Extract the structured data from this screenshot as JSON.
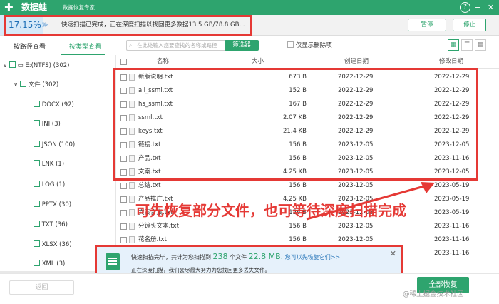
{
  "titlebar": {
    "logo": "✚",
    "app_name": "数据蛙",
    "subtitle": "数据恢复专家",
    "help": "?",
    "minimize": "−",
    "close": "✕"
  },
  "progress": {
    "percent_label": "17.15%",
    "percent_value": 17.15,
    "status": "快速扫描已完成，正在深度扫描以找回更多数据13.5 GB/78.8 GB...",
    "pause": "暂停",
    "stop": "停止"
  },
  "tabs": {
    "by_path": "按路径查看",
    "by_type": "按类型查看"
  },
  "tree": {
    "drive": "E:(NTFS) (302)",
    "folder": "文件 (302)",
    "types": [
      "DOCX (92)",
      "INI (3)",
      "JSON (100)",
      "LNK (1)",
      "LOG (1)",
      "PPTX (30)",
      "TXT (36)",
      "XLSX (36)",
      "XML (3)"
    ]
  },
  "toolbar": {
    "search_placeholder": "在此处输入您要查找的名称或路径",
    "filter": "筛选器",
    "deleted_only": "仅显示删除项"
  },
  "table": {
    "headers": {
      "name": "名称",
      "size": "大小",
      "created": "创建日期",
      "modified": "修改日期"
    },
    "rows": [
      {
        "name": "新版说明.txt",
        "size": "673  B",
        "created": "2022-12-29",
        "modified": "2022-12-29"
      },
      {
        "name": "ali_ssml.txt",
        "size": "152  B",
        "created": "2022-12-29",
        "modified": "2022-12-29"
      },
      {
        "name": "hs_ssml.txt",
        "size": "167  B",
        "created": "2022-12-29",
        "modified": "2022-12-29"
      },
      {
        "name": "ssml.txt",
        "size": "2.07 KB",
        "created": "2022-12-29",
        "modified": "2022-12-29"
      },
      {
        "name": "keys.txt",
        "size": "21.4 KB",
        "created": "2022-12-29",
        "modified": "2022-12-29"
      },
      {
        "name": "链接.txt",
        "size": "156  B",
        "created": "2023-12-05",
        "modified": "2023-12-05"
      },
      {
        "name": "产品.txt",
        "size": "156  B",
        "created": "2023-12-05",
        "modified": "2023-11-16"
      },
      {
        "name": "文案.txt",
        "size": "4.25 KB",
        "created": "2023-12-05",
        "modified": "2023-12-05"
      },
      {
        "name": "总结.txt",
        "size": "156  B",
        "created": "2023-12-05",
        "modified": "2023-05-19"
      },
      {
        "name": "产品推广.txt",
        "size": "4.25 KB",
        "created": "2023-12-05",
        "modified": "2023-05-19"
      },
      {
        "name": "文案合集.txt",
        "size": "156  B",
        "created": "2023-12-05",
        "modified": "2023-05-19"
      },
      {
        "name": "分镜头文本.txt",
        "size": "156  B",
        "created": "2023-12-05",
        "modified": "2023-11-16"
      },
      {
        "name": "花名册.txt",
        "size": "156  B",
        "created": "2023-12-05",
        "modified": "2023-11-16"
      },
      {
        "name": "",
        "size": "",
        "created": "",
        "modified": "2023-11-16"
      },
      {
        "name": "",
        "size": "",
        "created": "",
        "modified": "2023-11-16"
      }
    ]
  },
  "annotation": "可先恢复部分文件，也可等待深度扫描完成",
  "notice": {
    "line1_prefix": "快速扫描完毕，共计为您扫描到",
    "count": "238",
    "line1_mid": "个文件",
    "size": "22.8 MB.",
    "link": "您可以先恢复它们>>",
    "line2": "正在深度扫描，我们会尽最大努力为您找回更多丢失文件。",
    "close": "✕"
  },
  "bottom": {
    "back": "返回",
    "recover_all": "全部恢复"
  },
  "watermark": "@稀土掘金技术社区",
  "colors": {
    "accent": "#2ea46e",
    "highlight": "#e53935",
    "link": "#1c6eb5"
  }
}
